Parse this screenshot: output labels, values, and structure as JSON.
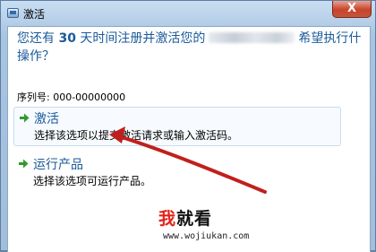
{
  "window": {
    "title": "激活",
    "close_label": "X"
  },
  "dialog": {
    "question_line1_prefix": "您还有",
    "question_days": "30",
    "question_line1_suffix": "天时间注册并激活您的",
    "question_line1_end": "希望执行什",
    "question_line2": "操作？",
    "serial_label": "序列号: 000-00000000"
  },
  "options": [
    {
      "title": "激活",
      "description": "选择该选项以提交激活请求或输入激活码。",
      "icon": "green-arrow-icon"
    },
    {
      "title": "运行产品",
      "description": "选择该选项可运行产品。",
      "icon": "green-arrow-icon"
    }
  ],
  "watermark": {
    "text_red": "我",
    "text_black": "就看",
    "url": "www.wojiukan.com"
  },
  "colors": {
    "link_blue": "#1b5a9a",
    "annotation_red": "#c0201c",
    "option_arrow_green": "#2e9b2e",
    "close_button_red": "#c8442a"
  }
}
